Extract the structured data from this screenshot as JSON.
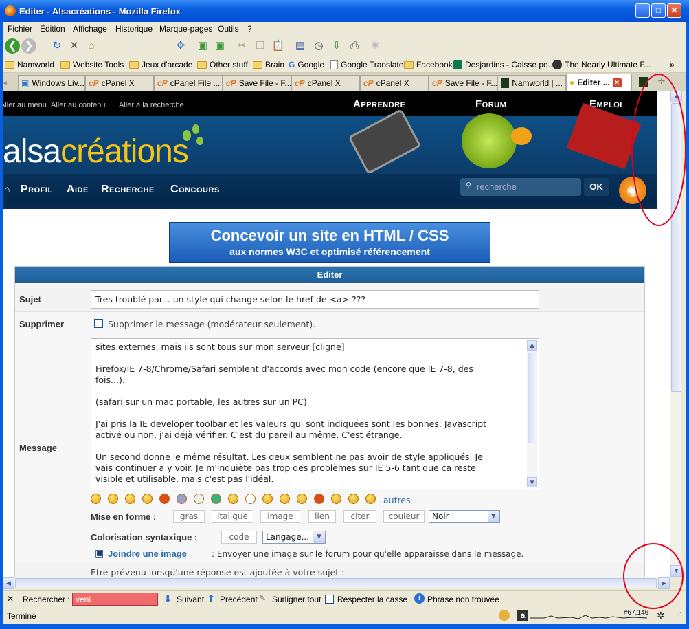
{
  "window": {
    "title": "Editer - Alsacréations - Mozilla Firefox"
  },
  "menu": [
    "Fichier",
    "Édition",
    "Affichage",
    "Historique",
    "Marque-pages",
    "Outils",
    "?"
  ],
  "bookmarks": [
    "Namworld",
    "Website Tools",
    "Jeux d'arcade",
    "Other stuff",
    "Brain",
    "Google",
    "Google Translate",
    "Facebook",
    "Desjardins - Caisse po...",
    "The Nearly Ultimate F..."
  ],
  "tabs": [
    {
      "label": "Windows Liv..."
    },
    {
      "label": "cPanel X"
    },
    {
      "label": "cPanel File ..."
    },
    {
      "label": "Save File - F..."
    },
    {
      "label": "cPanel X"
    },
    {
      "label": "cPanel X"
    },
    {
      "label": "Save File - F..."
    },
    {
      "label": "Namworld | ..."
    },
    {
      "label": "Editer ..."
    }
  ],
  "site": {
    "skip_links": [
      "Aller au menu",
      "Aller au contenu",
      "Aller à la recherche"
    ],
    "top_nav": [
      "Apprendre",
      "Forum",
      "Emploi"
    ],
    "logo_a": "alsa",
    "logo_b": "créations",
    "main_nav": [
      "Profil",
      "Aide",
      "Recherche",
      "Concours"
    ],
    "search_placeholder": "recherche",
    "ok": "OK",
    "banner_line1": "Concevoir un site en HTML / CSS",
    "banner_line2": "aux normes W3C et optimisé référencement"
  },
  "form": {
    "header": "Editer",
    "subject_label": "Sujet",
    "subject_value": "Tres troublé par... un style qui change selon le href de <a> ???",
    "delete_label": "Supprimer",
    "delete_checkbox": "Supprimer le message (modérateur seulement).",
    "message_label": "Message",
    "message_lines": [
      "sites externes, mais ils sont tous sur mon serveur [cligne]",
      "",
      "Firefox/IE 7-8/Chrome/Safari semblent d'accords avec mon code (encore que IE 7-8, des",
      "fois...).",
      "",
      "(safari sur un mac portable, les autres sur un PC)",
      "",
      "J'ai pris la IE developer toolbar et les valeurs qui sont indiquées sont les bonnes. Javascript",
      "activé ou non, j'ai déjà vérifier. C'est du pareil au même. C'est étrange.",
      "",
      "Un second donne le même résultat. Les deux semblent ne pas avoir de style appliqués. Je",
      "vais continuer a y voir. Je m'inquiète pas trop des problèmes sur IE 5-6 tant que ca reste",
      "visible et utilisable, mais c'est pas l'idéal."
    ],
    "autres": "autres",
    "format_label": "Mise en forme :",
    "format_buttons": [
      "gras",
      "italique",
      "image",
      "lien",
      "citer",
      "couleur"
    ],
    "color_select": "Noir",
    "syntax_label": "Colorisation syntaxique :",
    "code_button": "code",
    "lang_select": "Langage...",
    "attach_link": "Joindre une image",
    "attach_text": ": Envoyer une image sur le forum pour qu'elle apparaisse dans le message.",
    "notify_text": "Etre prévenu lorsqu'une réponse est ajoutée à votre sujet :"
  },
  "findbar": {
    "label": "Rechercher :",
    "value": "veni",
    "next": "Suivant",
    "prev": "Précédent",
    "highlight": "Surligner tout",
    "match_case": "Respecter la casse",
    "status": "Phrase non trouvée"
  },
  "status": {
    "text": "Terminé",
    "rank": "#67,146"
  }
}
